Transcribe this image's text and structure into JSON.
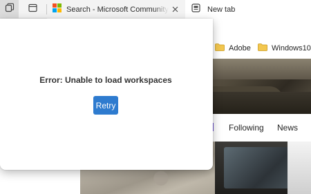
{
  "tabs": [
    {
      "title": "Search - Microsoft Community H",
      "favicon": "microsoft-logo-icon",
      "active": true
    },
    {
      "title": "New tab",
      "favicon": "new-tab-icon",
      "active": false
    }
  ],
  "favorites": [
    {
      "label": "Adobe",
      "icon": "folder-icon"
    },
    {
      "label": "Windows10",
      "icon": "folder-icon"
    }
  ],
  "page_nav": [
    "Following",
    "News"
  ],
  "popup": {
    "error_message": "Error: Unable to load workspaces",
    "retry_label": "Retry"
  },
  "colors": {
    "accent": "#2e7bcf",
    "folder": "#f3c74f",
    "ms_red": "#f25022",
    "ms_green": "#7fba00",
    "ms_blue": "#00a4ef",
    "ms_yellow": "#ffb900"
  }
}
